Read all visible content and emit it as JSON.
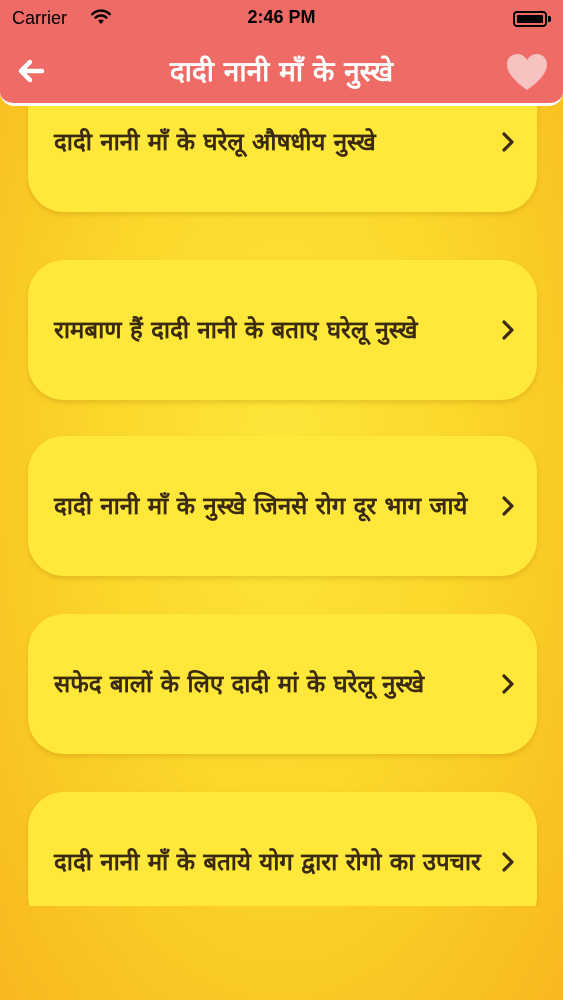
{
  "status_bar": {
    "carrier": "Carrier",
    "time": "2:46 PM",
    "icons": [
      "wifi-icon",
      "battery-icon"
    ]
  },
  "nav": {
    "title": "दादी नानी माँ के नुस्खे",
    "back_icon": "arrow-left-icon",
    "favorite_icon": "heart-icon"
  },
  "colors": {
    "header": "#ee6b66",
    "card": "#ffe83a",
    "background": "#fbd82a",
    "text": "#3a2a12"
  },
  "list": {
    "items": [
      {
        "label": "दादी नानी माँ के घरेलू औषधीय नुस्खे",
        "icon": "chevron-right-icon"
      },
      {
        "label": "रामबाण हैं दादी नानी के बताए घरेलू नुस्खे",
        "icon": "chevron-right-icon"
      },
      {
        "label": "दादी नानी माँ के नुस्खे जिनसे रोग दूर भाग जाये",
        "icon": "chevron-right-icon"
      },
      {
        "label": "सफेद बालों के लिए दादी मां के घरेलू नुस्खे",
        "icon": "chevron-right-icon"
      },
      {
        "label": "दादी नानी माँ के बताये योग द्वारा रोगो का उपचार",
        "icon": "chevron-right-icon"
      }
    ]
  }
}
